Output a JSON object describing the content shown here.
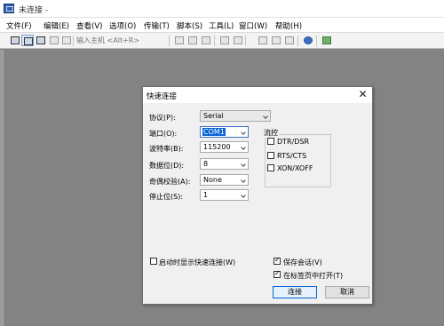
{
  "window": {
    "title": "未连接 -"
  },
  "menu": [
    "文件(F)",
    "编辑(E)",
    "查看(V)",
    "选项(O)",
    "传输(T)",
    "脚本(S)",
    "工具(L)",
    "窗口(W)",
    "帮助(H)"
  ],
  "toolbar": {
    "host_placeholder": "输入主机 <Alt+R>"
  },
  "dialog": {
    "title": "快速连接",
    "close_glyph": "✕",
    "fields": {
      "protocol": {
        "label": "协议(P):",
        "value": "Serial"
      },
      "port": {
        "label": "端口(O):",
        "value": "COM1"
      },
      "baud": {
        "label": "波特率(B):",
        "value": "115200"
      },
      "databits": {
        "label": "数据位(D):",
        "value": "8"
      },
      "parity": {
        "label": "奇偶校验(A):",
        "value": "None"
      },
      "stopbits": {
        "label": "停止位(S):",
        "value": "1"
      }
    },
    "flow": {
      "title": "流控",
      "items": [
        {
          "label": "DTR/DSR",
          "checked": false
        },
        {
          "label": "RTS/CTS",
          "checked": false
        },
        {
          "label": "XON/XOFF",
          "checked": false
        }
      ]
    },
    "startup_option": {
      "label": "启动时显示快速连接(W)",
      "checked": false
    },
    "save_session": {
      "label": "保存会话(V)",
      "checked": true
    },
    "open_in_tab": {
      "label": "在标签页中打开(T)",
      "checked": true
    },
    "connect_label": "连接",
    "cancel_label": "取消"
  }
}
